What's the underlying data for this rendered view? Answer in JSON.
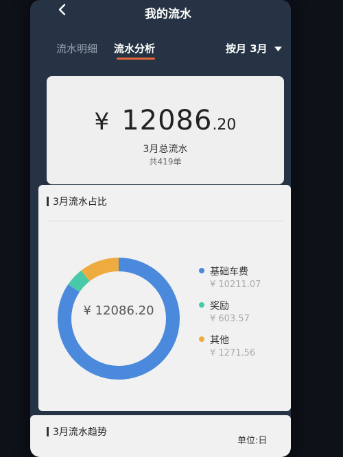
{
  "header": {
    "back_icon": "chevron-left-icon",
    "title": "我的流水"
  },
  "tabs": [
    {
      "label": "流水明细",
      "active": false
    },
    {
      "label": "流水分析",
      "active": true
    }
  ],
  "filter": {
    "label": "按月 3月",
    "icon": "caret-down-icon"
  },
  "summary": {
    "currency": "¥",
    "amount_int": "12086",
    "amount_dec": ".20",
    "label": "3月总流水",
    "count": "共419单"
  },
  "breakdown": {
    "title": "3月流水占比",
    "center_text": "¥ 12086.20",
    "items": [
      {
        "name": "基础车费",
        "value": "¥ 10211.07",
        "color": "#4a89dc"
      },
      {
        "name": "奖励",
        "value": "¥ 603.57",
        "color": "#48c9a9"
      },
      {
        "name": "其他",
        "value": "¥ 1271.56",
        "color": "#eeab3f"
      }
    ]
  },
  "chart_data": {
    "type": "pie",
    "categories": [
      "基础车费",
      "奖励",
      "其他"
    ],
    "values": [
      10211.07,
      603.57,
      1271.56
    ],
    "title": "3月流水占比"
  },
  "trend": {
    "title": "3月流水趋势",
    "unit": "单位:日"
  }
}
